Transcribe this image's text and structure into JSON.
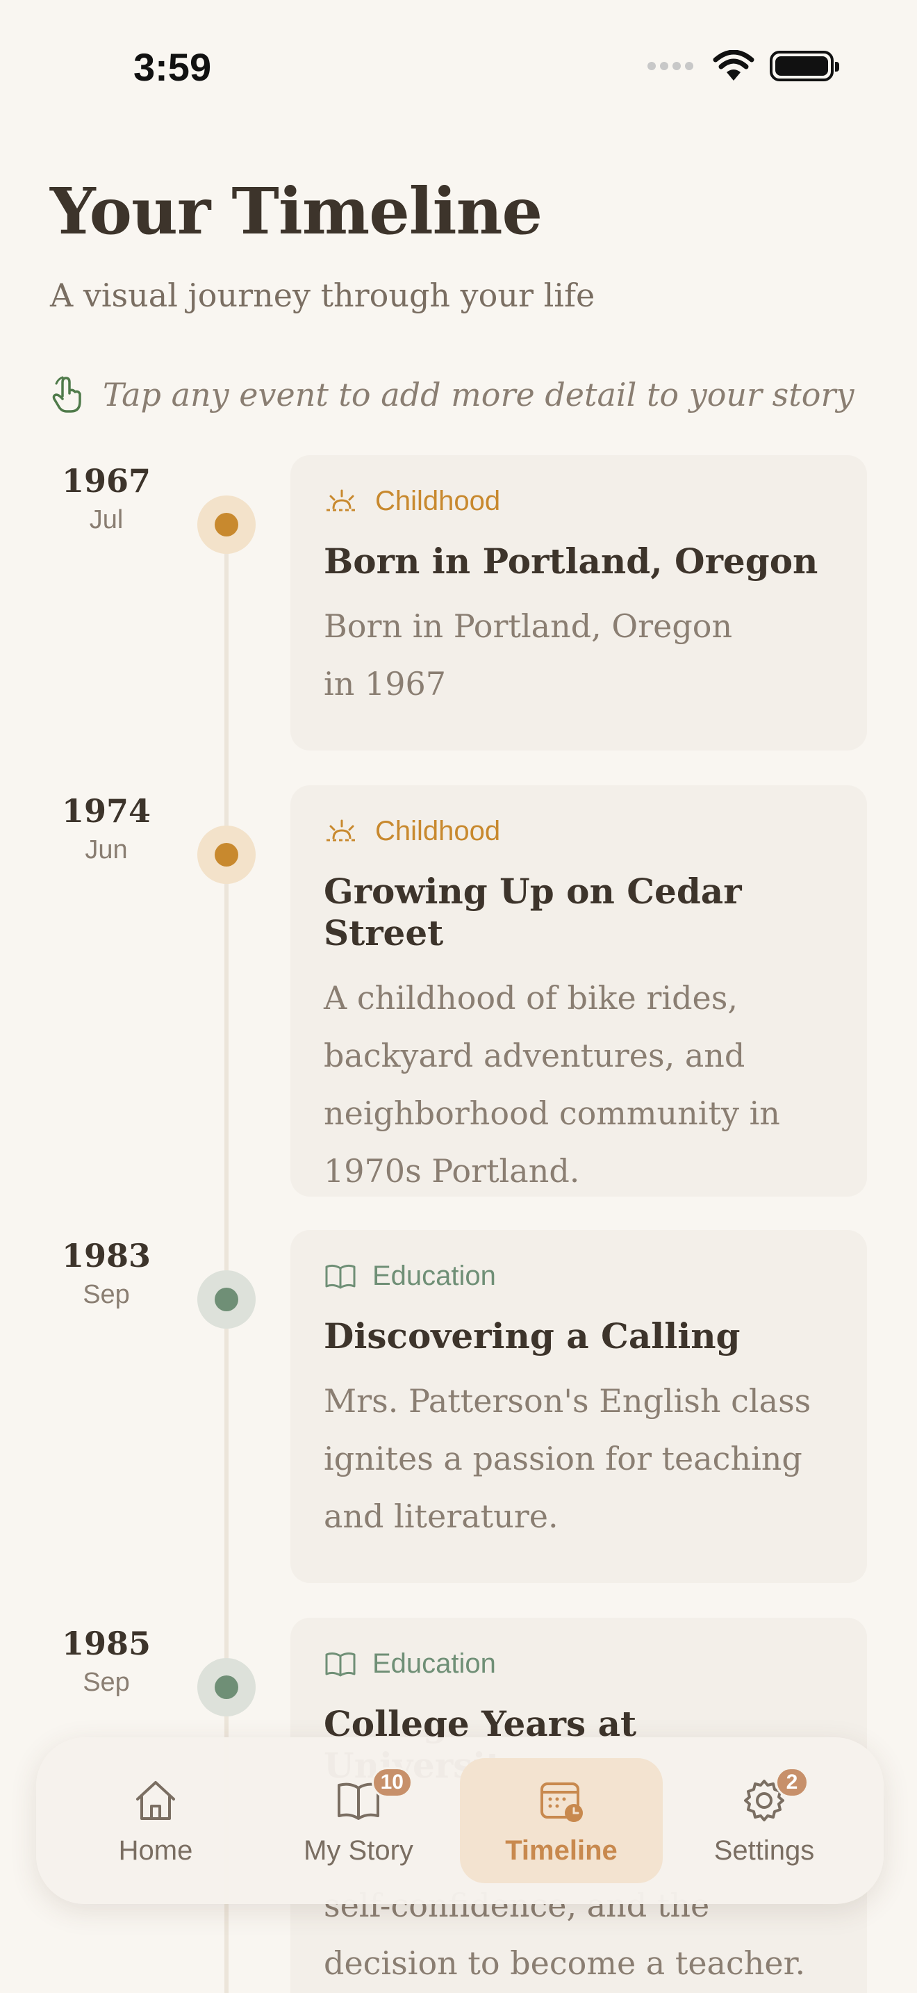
{
  "status_bar": {
    "time": "3:59"
  },
  "header": {
    "title": "Your Timeline",
    "subtitle": "A visual journey through your life",
    "hint": "Tap any event to add more detail to your story"
  },
  "events": [
    {
      "year": "1967",
      "month": "Jul",
      "category": "Childhood",
      "category_icon": "sunrise-icon",
      "title": "Born in Portland, Oregon",
      "description": [
        "Born in Portland, Oregon",
        "in 1967"
      ]
    },
    {
      "year": "1974",
      "month": "Jun",
      "category": "Childhood",
      "category_icon": "sunrise-icon",
      "title": "Growing Up on Cedar Street",
      "description": [
        "A childhood of bike rides,",
        "backyard adventures, and",
        "neighborhood community in",
        "1970s Portland."
      ]
    },
    {
      "year": "1983",
      "month": "Sep",
      "category": "Education",
      "category_icon": "book-icon",
      "title": "Discovering a Calling",
      "description": [
        "Mrs. Patterson's English class",
        "ignites a passion for teaching",
        "and literature."
      ]
    },
    {
      "year": "1985",
      "month": "Sep",
      "category": "Education",
      "category_icon": "book-icon",
      "title": "College Years at University",
      "description": [
        "self-confidence, and the",
        "decision to become a teacher."
      ]
    }
  ],
  "tabbar": {
    "tabs": [
      {
        "label": "Home",
        "icon": "home-icon",
        "badge": ""
      },
      {
        "label": "My Story",
        "icon": "book-icon",
        "badge": "10"
      },
      {
        "label": "Timeline",
        "icon": "calendar-clock-icon",
        "badge": "",
        "active": true
      },
      {
        "label": "Settings",
        "icon": "gear-icon",
        "badge": "2"
      }
    ]
  },
  "colors": {
    "background": "#F9F6F1",
    "childhood_accent": "#C8892E",
    "education_accent": "#6F8F76",
    "active_tab": "#C8894E",
    "badge": "#C7906A"
  }
}
